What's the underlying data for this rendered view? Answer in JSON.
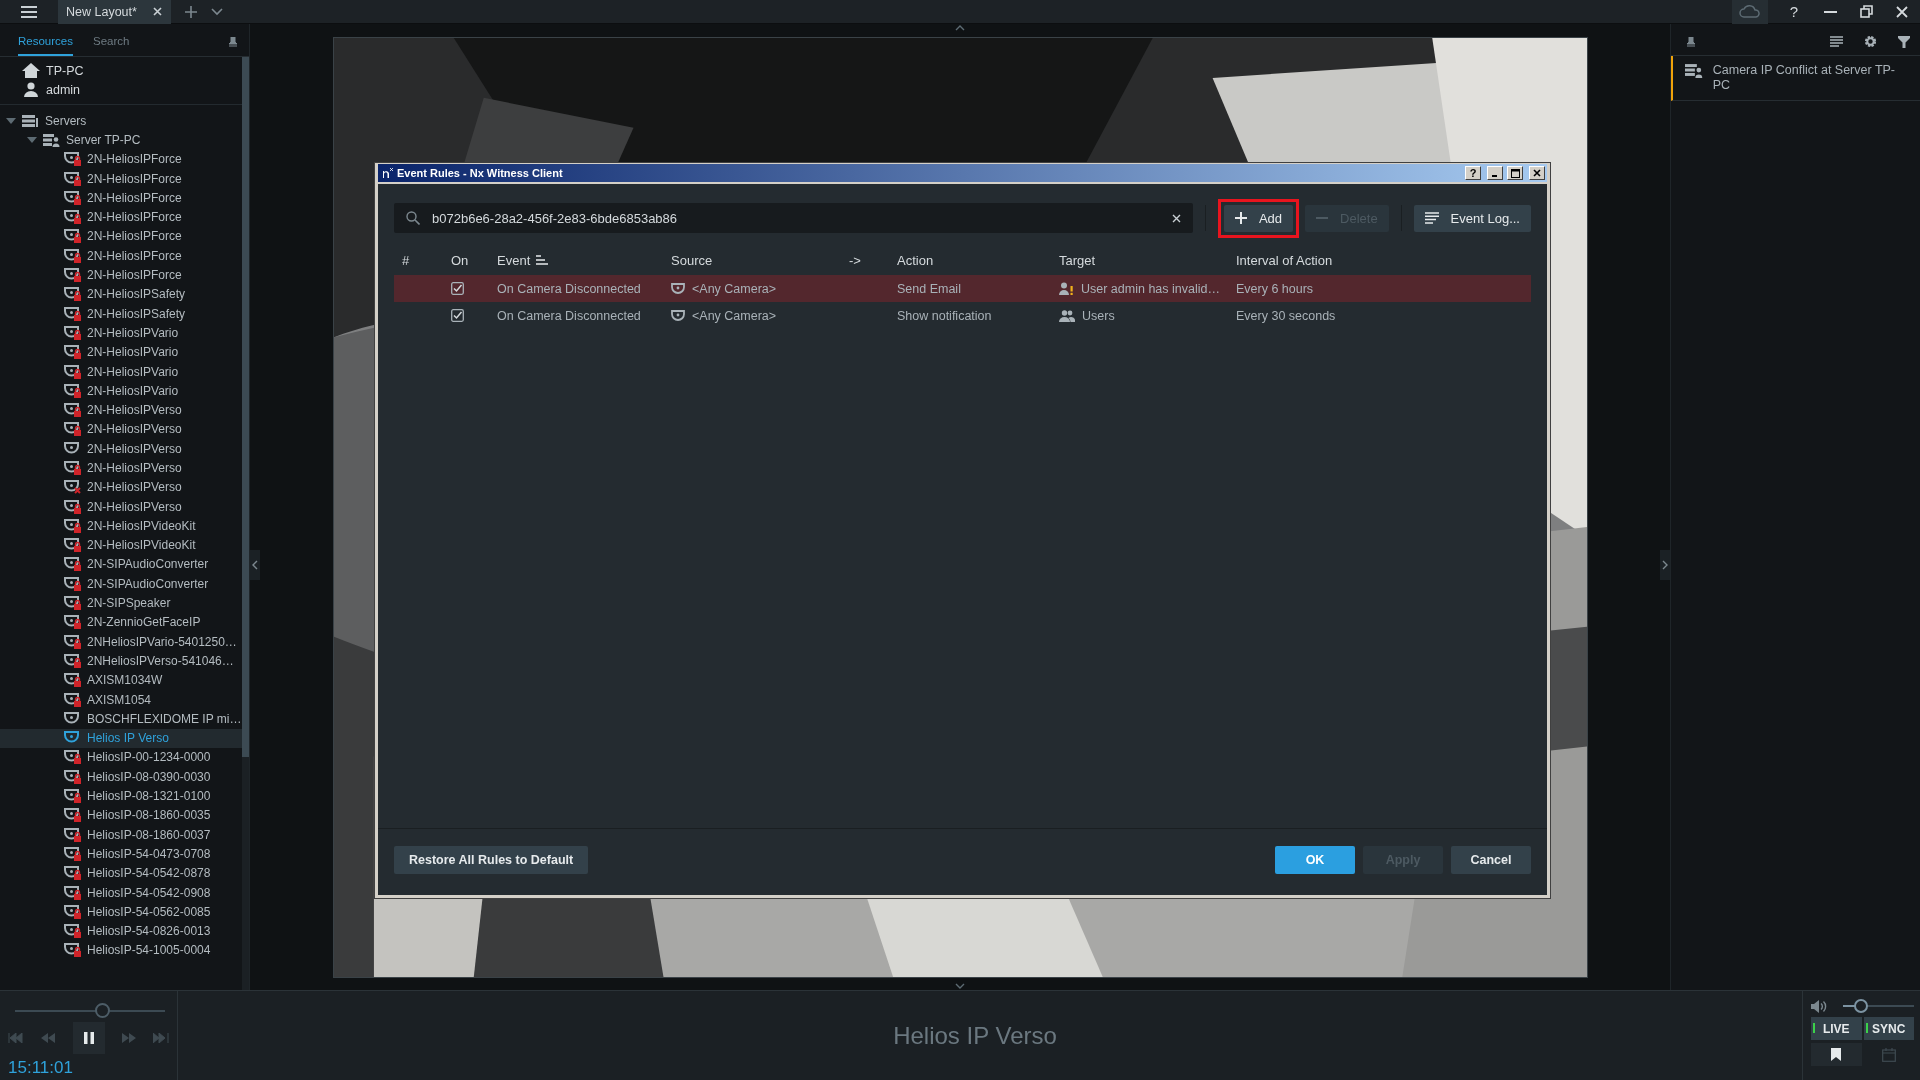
{
  "top_bar": {
    "tabs": [
      {
        "label": "New Layout*",
        "selected": true
      }
    ],
    "help": "?"
  },
  "left_panel": {
    "tabs": [
      {
        "label": "Resources",
        "selected": true
      },
      {
        "label": "Search",
        "selected": false
      }
    ],
    "system": "TP-PC",
    "user": "admin",
    "tree": [
      {
        "label": "Servers",
        "kind": "servers",
        "expanded": true,
        "children": [
          {
            "label": "Server TP-PC",
            "kind": "server",
            "expanded": true,
            "children": [
              {
                "label": "2N-HeliosIPForce",
                "kind": "camera",
                "locked": true,
                "error": false,
                "selected": false
              },
              {
                "label": "2N-HeliosIPForce",
                "kind": "camera",
                "locked": true,
                "error": false,
                "selected": false
              },
              {
                "label": "2N-HeliosIPForce",
                "kind": "camera",
                "locked": true,
                "error": false,
                "selected": false
              },
              {
                "label": "2N-HeliosIPForce",
                "kind": "camera",
                "locked": true,
                "error": false,
                "selected": false
              },
              {
                "label": "2N-HeliosIPForce",
                "kind": "camera",
                "locked": true,
                "error": false,
                "selected": false
              },
              {
                "label": "2N-HeliosIPForce",
                "kind": "camera",
                "locked": true,
                "error": false,
                "selected": false
              },
              {
                "label": "2N-HeliosIPForce",
                "kind": "camera",
                "locked": true,
                "error": false,
                "selected": false
              },
              {
                "label": "2N-HeliosIPSafety",
                "kind": "camera",
                "locked": true,
                "error": false,
                "selected": false
              },
              {
                "label": "2N-HeliosIPSafety",
                "kind": "camera",
                "locked": true,
                "error": false,
                "selected": false
              },
              {
                "label": "2N-HeliosIPVario",
                "kind": "camera",
                "locked": true,
                "error": false,
                "selected": false
              },
              {
                "label": "2N-HeliosIPVario",
                "kind": "camera",
                "locked": true,
                "error": false,
                "selected": false
              },
              {
                "label": "2N-HeliosIPVario",
                "kind": "camera",
                "locked": true,
                "error": false,
                "selected": false
              },
              {
                "label": "2N-HeliosIPVario",
                "kind": "camera",
                "locked": true,
                "error": false,
                "selected": false
              },
              {
                "label": "2N-HeliosIPVerso",
                "kind": "camera",
                "locked": true,
                "error": false,
                "selected": false
              },
              {
                "label": "2N-HeliosIPVerso",
                "kind": "camera",
                "locked": true,
                "error": false,
                "selected": false
              },
              {
                "label": "2N-HeliosIPVerso",
                "kind": "camera",
                "locked": false,
                "error": false,
                "selected": false
              },
              {
                "label": "2N-HeliosIPVerso",
                "kind": "camera",
                "locked": true,
                "error": false,
                "selected": false
              },
              {
                "label": "2N-HeliosIPVerso",
                "kind": "camera",
                "locked": false,
                "error": true,
                "selected": false
              },
              {
                "label": "2N-HeliosIPVerso",
                "kind": "camera",
                "locked": true,
                "error": false,
                "selected": false
              },
              {
                "label": "2N-HeliosIPVideoKit",
                "kind": "camera",
                "locked": true,
                "error": false,
                "selected": false
              },
              {
                "label": "2N-HeliosIPVideoKit",
                "kind": "camera",
                "locked": true,
                "error": false,
                "selected": false
              },
              {
                "label": "2N-SIPAudioConverter",
                "kind": "camera",
                "locked": true,
                "error": false,
                "selected": false
              },
              {
                "label": "2N-SIPAudioConverter",
                "kind": "camera",
                "locked": true,
                "error": false,
                "selected": false
              },
              {
                "label": "2N-SIPSpeaker",
                "kind": "camera",
                "locked": true,
                "error": false,
                "selected": false
              },
              {
                "label": "2N-ZennioGetFaceIP",
                "kind": "camera",
                "locked": true,
                "error": false,
                "selected": false
              },
              {
                "label": "2NHeliosIPVario-5401250…",
                "kind": "camera",
                "locked": true,
                "error": false,
                "selected": false
              },
              {
                "label": "2NHeliosIPVerso-541046…",
                "kind": "camera",
                "locked": true,
                "error": false,
                "selected": false
              },
              {
                "label": "AXISM1034W",
                "kind": "camera",
                "locked": true,
                "error": false,
                "selected": false
              },
              {
                "label": "AXISM1054",
                "kind": "camera",
                "locked": true,
                "error": false,
                "selected": false
              },
              {
                "label": "BOSCHFLEXIDOME IP mi…",
                "kind": "camera",
                "locked": false,
                "error": false,
                "selected": false
              },
              {
                "label": "Helios IP Verso",
                "kind": "camera",
                "locked": false,
                "error": false,
                "selected": true
              },
              {
                "label": "HeliosIP-00-1234-0000",
                "kind": "camera",
                "locked": true,
                "error": false,
                "selected": false
              },
              {
                "label": "HeliosIP-08-0390-0030",
                "kind": "camera",
                "locked": true,
                "error": false,
                "selected": false
              },
              {
                "label": "HeliosIP-08-1321-0100",
                "kind": "camera",
                "locked": true,
                "error": false,
                "selected": false
              },
              {
                "label": "HeliosIP-08-1860-0035",
                "kind": "camera",
                "locked": true,
                "error": false,
                "selected": false
              },
              {
                "label": "HeliosIP-08-1860-0037",
                "kind": "camera",
                "locked": true,
                "error": false,
                "selected": false
              },
              {
                "label": "HeliosIP-54-0473-0708",
                "kind": "camera",
                "locked": true,
                "error": false,
                "selected": false
              },
              {
                "label": "HeliosIP-54-0542-0878",
                "kind": "camera",
                "locked": true,
                "error": false,
                "selected": false
              },
              {
                "label": "HeliosIP-54-0542-0908",
                "kind": "camera",
                "locked": true,
                "error": false,
                "selected": false
              },
              {
                "label": "HeliosIP-54-0562-0085",
                "kind": "camera",
                "locked": true,
                "error": false,
                "selected": false
              },
              {
                "label": "HeliosIP-54-0826-0013",
                "kind": "camera",
                "locked": true,
                "error": false,
                "selected": false
              },
              {
                "label": "HeliosIP-54-1005-0004",
                "kind": "camera",
                "locked": true,
                "error": false,
                "selected": false
              }
            ]
          }
        ]
      }
    ]
  },
  "dialog": {
    "title": "Event Rules - Nx Witness Client",
    "title_buttons": {
      "help": "?"
    },
    "search": {
      "value": "b072b6e6-28a2-456f-2e83-6bde6853ab86"
    },
    "buttons": [
      {
        "label": "Add",
        "kind": "add",
        "disabled": false,
        "highlighted": true
      },
      {
        "label": "Delete",
        "kind": "delete",
        "disabled": true,
        "highlighted": false
      },
      {
        "label": "Event Log...",
        "kind": "log",
        "disabled": false,
        "highlighted": false
      }
    ],
    "columns": [
      "#",
      "On",
      "Event",
      "Source",
      "->",
      "Action",
      "Target",
      "Interval of Action"
    ],
    "rows": [
      {
        "selected": true,
        "on": true,
        "event": "On Camera Disconnected",
        "source": "<Any Camera>",
        "action": "Send Email",
        "target": "User admin has invalid…",
        "kind": "user_warning",
        "interval": "Every 6 hours"
      },
      {
        "selected": false,
        "on": true,
        "event": "On Camera Disconnected",
        "source": "<Any Camera>",
        "action": "Show notification",
        "target": "Users",
        "kind": "users",
        "interval": "Every 30 seconds"
      }
    ],
    "restore_button": "Restore All Rules to Default",
    "footer_buttons": [
      {
        "label": "OK",
        "kind": "primary",
        "disabled": false
      },
      {
        "label": "Apply",
        "kind": "default",
        "disabled": true
      },
      {
        "label": "Cancel",
        "kind": "default",
        "disabled": false
      }
    ]
  },
  "right_panel": {
    "notifications": [
      {
        "text": "Camera IP Conflict at Server TP-PC"
      }
    ]
  },
  "bottom_bar": {
    "timeline": {
      "level": 0.58
    },
    "time": "15:11:01",
    "camera_name": "Helios IP Verso",
    "volume": {
      "level": 0.26
    },
    "toggles": [
      {
        "label": "LIVE",
        "on": true
      },
      {
        "label": "SYNC",
        "on": true
      }
    ]
  }
}
